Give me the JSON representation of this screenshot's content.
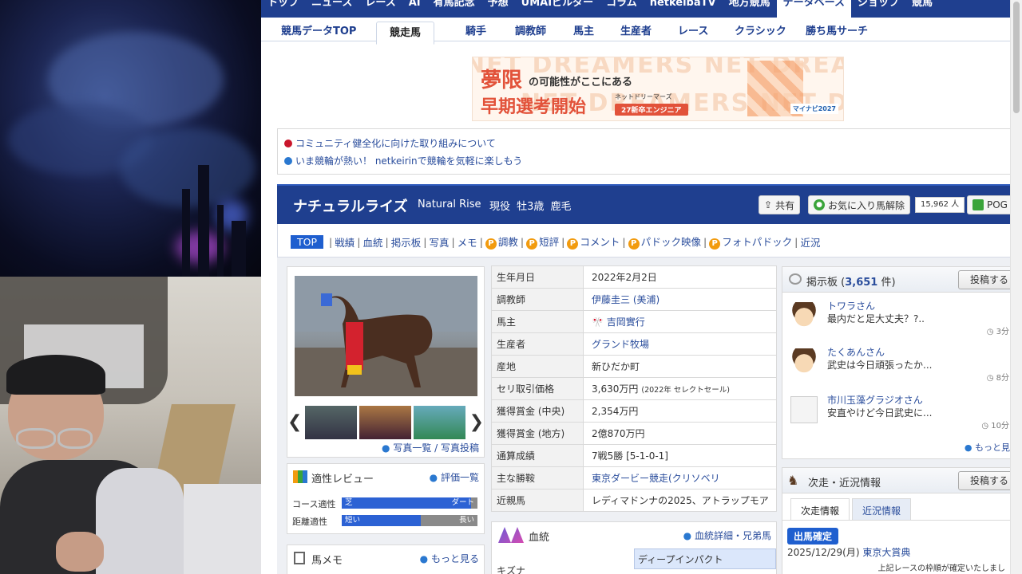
{
  "topnav": [
    "トップ",
    "ニュース",
    "レース",
    "AI",
    "有馬記念",
    "予想",
    "UMAIビルダー",
    "コラム",
    "netkeibaTV",
    "地方競馬",
    "データベース",
    "ショップ",
    "競馬"
  ],
  "subnav": [
    "競馬データTOP",
    "競走馬",
    "騎手",
    "調教師",
    "馬主",
    "生産者",
    "レース",
    "クラシック",
    "勝ち馬サーチ"
  ],
  "banner": {
    "bg_text": "NET DREAMERS NET DREAMERS",
    "line1_big": "夢限",
    "line1_rest": "の可能性がここにある",
    "line2": "早期選考開始",
    "company": "ネットドリーマーズ",
    "pill": "27新卒エンジニア",
    "brand": "マイナビ2027"
  },
  "notices": [
    "コミュニティ健全化に向けた取り組みについて",
    "いま競輪が熱い！ netkeirinで競輪を気軽に楽しもう"
  ],
  "horse": {
    "name": "ナチュラルライズ",
    "name_en": "Natural Rise",
    "meta": "現役 牡3歳 鹿毛",
    "share": "共有",
    "fav": "お気に入り馬解除",
    "fav_count": "15,962 人",
    "pog": "POG"
  },
  "tabs": [
    "TOP",
    "戦績",
    "血統",
    "掲示板",
    "写真",
    "メモ",
    "調教",
    "短評",
    "コメント",
    "パドック映像",
    "フォトパドック",
    "近況"
  ],
  "photo_links": "写真一覧 / 写真投稿",
  "review": {
    "title": "適性レビュー",
    "link": "評価一覧",
    "course_label": "コース適性",
    "course_left": "芝",
    "course_right": "ダート",
    "course_value": 0.95,
    "distance_label": "距離適性",
    "distance_left": "短い",
    "distance_right": "長い",
    "distance_value": 0.58
  },
  "memo": {
    "title": "馬メモ",
    "link": "もっと見る"
  },
  "profile": [
    {
      "k": "生年月日",
      "v": "2022年2月2日"
    },
    {
      "k": "調教師",
      "v": "伊藤圭三 (美浦)"
    },
    {
      "k": "馬主",
      "v": "吉岡實行"
    },
    {
      "k": "生産者",
      "v": "グランド牧場"
    },
    {
      "k": "産地",
      "v": "新ひだか町"
    },
    {
      "k": "セリ取引価格",
      "v": "3,630万円",
      "note": "(2022年 セレクトセール)"
    },
    {
      "k": "獲得賞金 (中央)",
      "v": "2,354万円"
    },
    {
      "k": "獲得賞金 (地方)",
      "v": "2億870万円"
    },
    {
      "k": "通算成績",
      "v": "7戦5勝 [5-1-0-1]"
    },
    {
      "k": "主な勝鞍",
      "v": "東京ダービー競走(クリソベリ"
    },
    {
      "k": "近親馬",
      "v": "レディマドンナの2025、アトラップモア"
    }
  ],
  "pedigree": {
    "title": "血統",
    "link": "血統詳細・兄弟馬",
    "father": "ディープインパクト",
    "horse": "キズナ"
  },
  "bbs": {
    "title": "掲示板",
    "count": "3,651",
    "count_suffix": "件)",
    "count_prefix": "(",
    "post": "投稿する",
    "posts": [
      {
        "name": "トワラさん",
        "msg": "最内だと足大丈夫？?..",
        "time": "3分"
      },
      {
        "name": "たくあんさん",
        "msg": "武史は今日頑張ったか...",
        "time": "8分"
      },
      {
        "name": "市川玉藻グラジオさん",
        "msg": "安直やけど今日武史に...",
        "time": "10分"
      }
    ],
    "more": "もっと見"
  },
  "next": {
    "title": "次走・近況情報",
    "post": "投稿する",
    "tab_active": "次走情報",
    "tab_other": "近況情報",
    "badge": "出馬確定",
    "date": "2025/12/29(月)",
    "race": "東京大賞典",
    "note": "上記レースの枠順が確定いたしまし"
  },
  "colors": {
    "navy": "#1f3f8f",
    "link": "#2a4d9c",
    "accent_orange": "#f29b0e",
    "bar_blue": "#2c62d4"
  }
}
